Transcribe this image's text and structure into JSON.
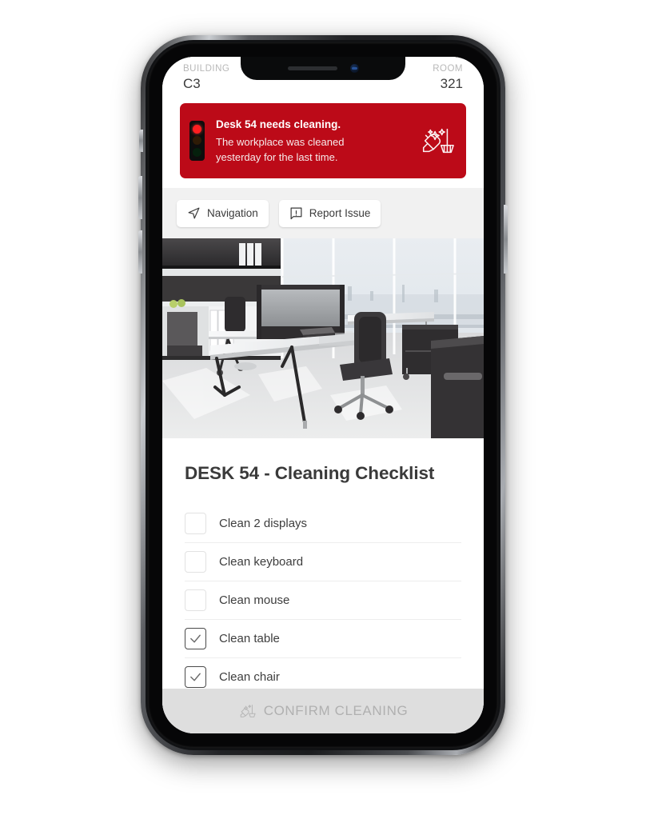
{
  "header": {
    "building_label": "BUILDING",
    "building_value": "C3",
    "room_label": "ROOM",
    "room_value": "321"
  },
  "alert": {
    "title": "Desk 54 needs cleaning.",
    "message_line1": "The workplace was cleaned",
    "message_line2": "yesterday  for the last time.",
    "status_icon": "traffic-light-red-icon",
    "side_icon": "cleaning-supplies-icon",
    "background_color": "#bc0a18",
    "lamp_color": "#ff1e20"
  },
  "toolbar": {
    "navigation_label": "Navigation",
    "navigation_icon": "navigation-arrow-icon",
    "report_label": "Report Issue",
    "report_icon": "report-issue-icon",
    "background_color": "#f1f1f1"
  },
  "hero": {
    "alt": "office-workspace-photo"
  },
  "checklist": {
    "title": "DESK 54 - Cleaning Checklist",
    "items": [
      {
        "label": "Clean 2 displays",
        "checked": false
      },
      {
        "label": "Clean keyboard",
        "checked": false
      },
      {
        "label": "Clean mouse",
        "checked": false
      },
      {
        "label": "Clean table",
        "checked": true
      },
      {
        "label": "Clean chair",
        "checked": true
      }
    ]
  },
  "confirm": {
    "label": "CONFIRM CLEANING",
    "icon": "cleaning-supplies-icon",
    "enabled": false,
    "background_color": "#dedede",
    "text_color": "#b0b0b0"
  }
}
